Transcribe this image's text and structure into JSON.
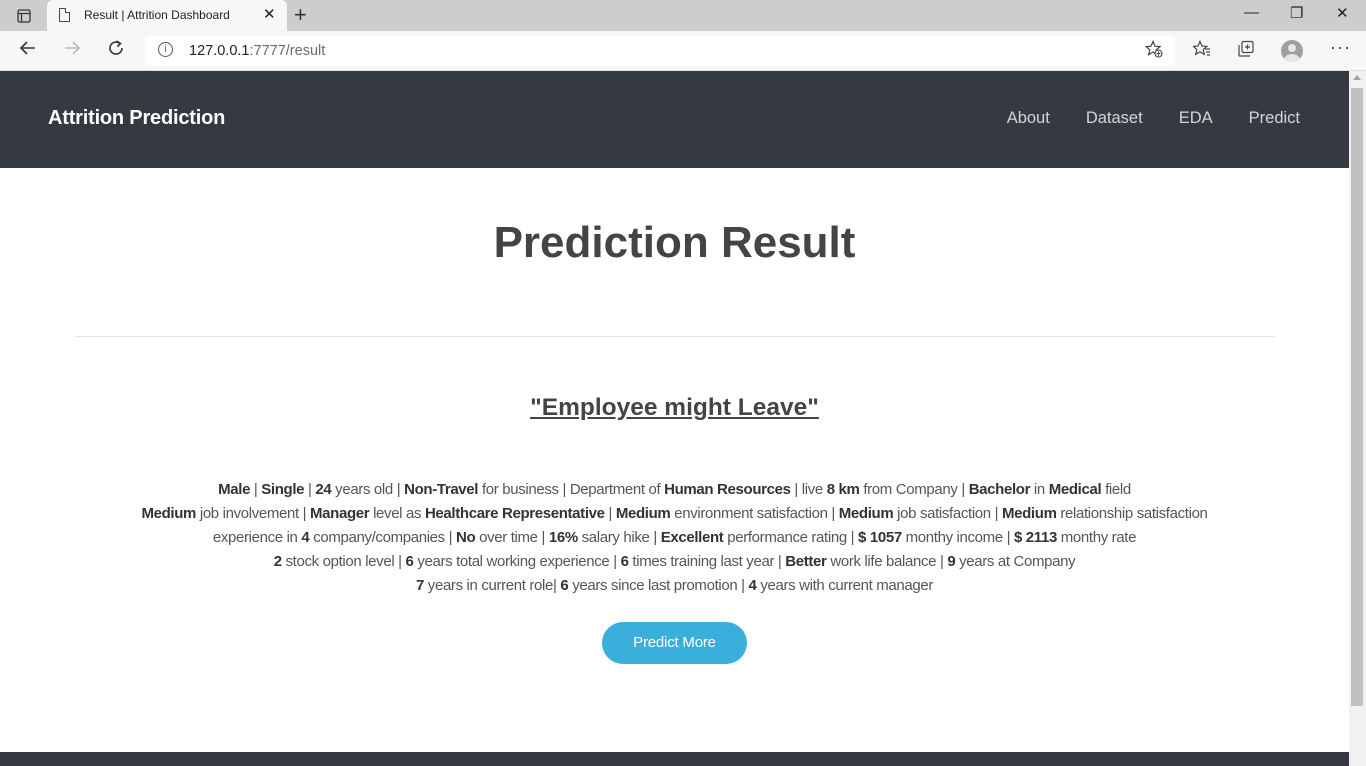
{
  "browser": {
    "tab_title": "Result | Attrition Dashboard",
    "tab_close": "✕",
    "new_tab": "+",
    "url_host": "127.0.0.1",
    "url_path": ":7777/result",
    "minimize": "—",
    "restore": "❐",
    "close": "✕"
  },
  "navbar": {
    "brand": "Attrition Prediction",
    "links": [
      "About",
      "Dataset",
      "EDA",
      "Predict"
    ]
  },
  "page": {
    "title": "Prediction Result",
    "verdict": "\"Employee might Leave\"",
    "button": "Predict More"
  },
  "employee": {
    "gender": "Male",
    "marital_status": "Single",
    "age": "24",
    "business_travel": "Non-Travel",
    "department": "Human Resources",
    "distance": "8 km",
    "education": "Bachelor",
    "education_field": "Medical",
    "job_involvement": "Medium",
    "job_level": "Manager",
    "job_role": "Healthcare Representative",
    "environment_satisfaction": "Medium",
    "job_satisfaction": "Medium",
    "relationship_satisfaction": "Medium",
    "num_companies": "4",
    "over_time": "No",
    "salary_hike": "16%",
    "performance_rating": "Excellent",
    "monthly_income": "$ 1057",
    "monthly_rate": "$ 2113",
    "stock_option_level": "2",
    "total_working_years": "6",
    "training_times": "6",
    "work_life_balance": "Better",
    "years_at_company": "9",
    "years_in_role": "7",
    "years_since_promotion": "6",
    "years_with_manager": "4"
  },
  "text": {
    "sep": " | ",
    "sep_tight": "| ",
    "years_old": " years old",
    "for_business": " for business",
    "department_of": "Department of ",
    "live": "live ",
    "from_company": " from Company",
    "in": " in ",
    "field": " field",
    "job_involvement": " job involvement",
    "level_as": " level as ",
    "environment_satisfaction": " environment satisfaction",
    "job_satisfaction": " job satisfaction",
    "relationship_satisfaction": " relationship satisfaction",
    "experience_in": "experience in ",
    "companies": " company/companies",
    "over_time": " over time",
    "salary_hike": " salary hike",
    "performance_rating": " performance rating",
    "monthly_income": " monthy income",
    "monthly_rate": " monthy rate",
    "stock_option_level": " stock option level",
    "total_working": " years total working experience",
    "training": " times training last year",
    "work_life_balance": " work life balance",
    "years_at_company": " years at Company",
    "years_in_role": " years in current role",
    "years_since_promotion": " years since last promotion",
    "years_with_manager": " years with current manager"
  }
}
